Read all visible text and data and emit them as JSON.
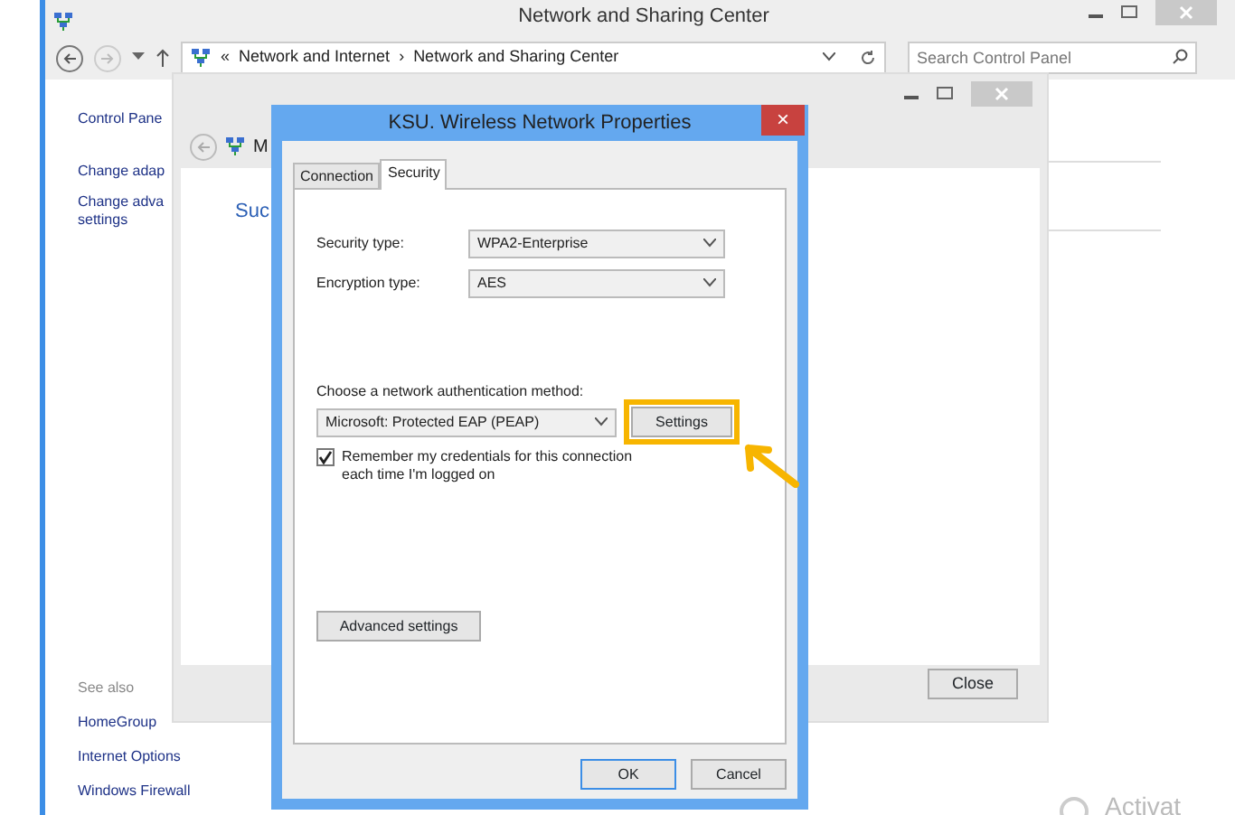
{
  "main_window": {
    "title": "Network and Sharing Center",
    "address": {
      "overflow": "«",
      "crumbs": [
        "Network and Internet",
        "Network and Sharing Center"
      ],
      "separator": "›"
    },
    "search": {
      "placeholder": "Search Control Panel"
    },
    "sidebar": {
      "links": [
        "Control Pane",
        "Change adap",
        "Change adva\nsettings"
      ],
      "see_also_heading": "See also",
      "see_also": [
        "HomeGroup",
        "Internet Options",
        "Windows Firewall"
      ]
    }
  },
  "middle_window": {
    "title": "M",
    "heading": "Suc",
    "close_button": "Close"
  },
  "dialog": {
    "title": "KSU. Wireless Network Properties",
    "close_glyph": "×",
    "tabs": [
      {
        "label": "Connection",
        "selected": false
      },
      {
        "label": "Security",
        "selected": true
      }
    ],
    "fields": [
      {
        "label": "Security type:",
        "value": "WPA2-Enterprise"
      },
      {
        "label": "Encryption type:",
        "value": "AES"
      }
    ],
    "auth_label": "Choose a network authentication method:",
    "auth_value": "Microsoft: Protected EAP (PEAP)",
    "settings_button": "Settings",
    "settings_highlighted": true,
    "remember": {
      "label": "Remember my credentials for this connection each time I'm logged on",
      "checked": true
    },
    "advanced_button": "Advanced settings",
    "buttons": [
      "OK",
      "Cancel"
    ]
  },
  "watermark_text": "Activat"
}
